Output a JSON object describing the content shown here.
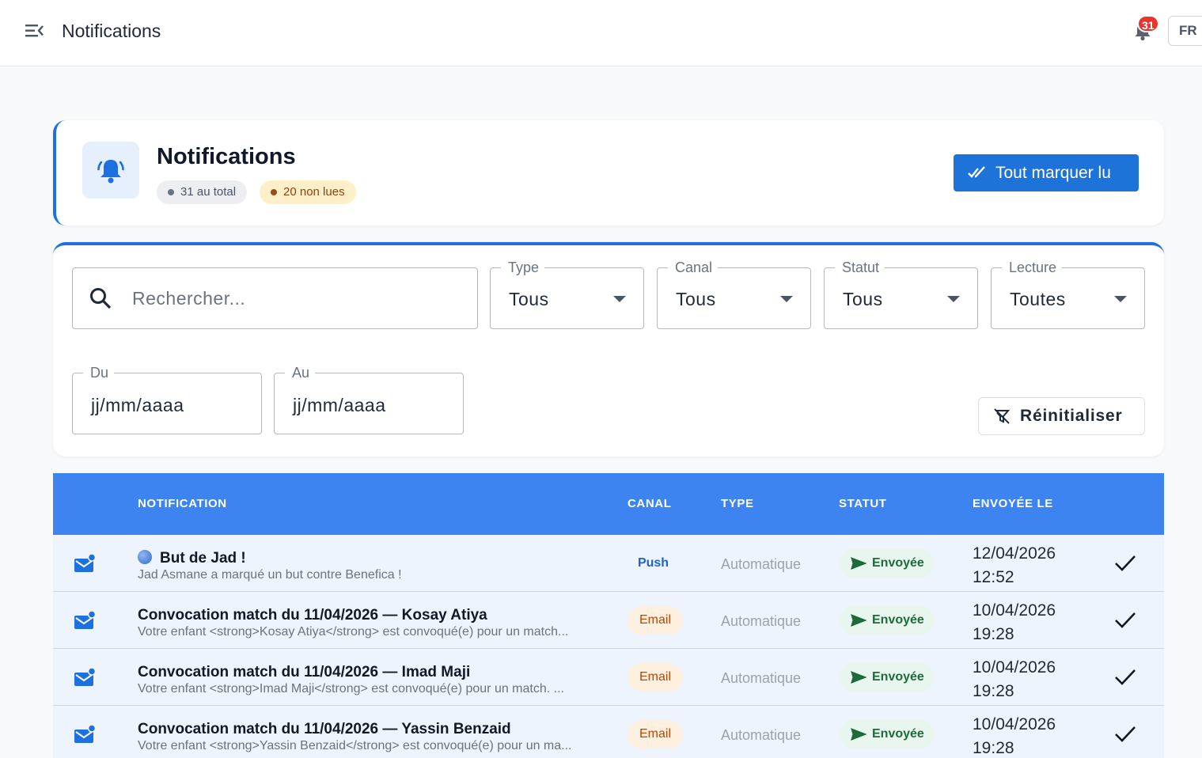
{
  "topbar": {
    "title": "Notifications",
    "notification_count": "31",
    "language": "FR"
  },
  "header": {
    "title": "Notifications",
    "total_label": "31 au total",
    "unread_label": "20 non lues",
    "mark_all_label": "Tout marquer lu"
  },
  "filters": {
    "search_placeholder": "Rechercher...",
    "type": {
      "label": "Type",
      "value": "Tous"
    },
    "canal": {
      "label": "Canal",
      "value": "Tous"
    },
    "statut": {
      "label": "Statut",
      "value": "Tous"
    },
    "lecture": {
      "label": "Lecture",
      "value": "Toutes"
    },
    "from": {
      "label": "Du",
      "value": "jj/mm/aaaa"
    },
    "to": {
      "label": "Au",
      "value": "jj/mm/aaaa"
    },
    "reset_label": "Réinitialiser"
  },
  "table": {
    "headers": {
      "notification": "NOTIFICATION",
      "canal": "CANAL",
      "type": "TYPE",
      "statut": "STATUT",
      "sent_at": "ENVOYÉE LE"
    },
    "rows": [
      {
        "title": "But de Jad !",
        "subtitle": "Jad Asmane a marqué un but contre Benefica !",
        "canal": "Push",
        "type": "Automatique",
        "status": "Envoyée",
        "date": "12/04/2026",
        "time": "12:52",
        "icon": "mail-unread-icon",
        "title_icon": "globe-icon"
      },
      {
        "title": "Convocation match du 11/04/2026 — Kosay Atiya",
        "subtitle": "Votre enfant <strong>Kosay Atiya</strong> est convoqué(e) pour un match...",
        "canal": "Email",
        "type": "Automatique",
        "status": "Envoyée",
        "date": "10/04/2026",
        "time": "19:28",
        "icon": "mail-unread-icon"
      },
      {
        "title": "Convocation match du 11/04/2026 — Imad Maji",
        "subtitle": "Votre enfant <strong>Imad Maji</strong> est convoqué(e) pour un match. ...",
        "canal": "Email",
        "type": "Automatique",
        "status": "Envoyée",
        "date": "10/04/2026",
        "time": "19:28",
        "icon": "mail-unread-icon"
      },
      {
        "title": "Convocation match du 11/04/2026 — Yassin Benzaid",
        "subtitle": "Votre enfant <strong>Yassin Benzaid</strong> est convoqué(e) pour un ma...",
        "canal": "Email",
        "type": "Automatique",
        "status": "Envoyée",
        "date": "10/04/2026",
        "time": "19:28",
        "icon": "mail-unread-icon"
      }
    ]
  },
  "colors": {
    "primary": "#1e73d9",
    "table_header": "#3d84f1",
    "row_background": "#eef4fe",
    "badge_red": "#e5372f",
    "status_green": "#1d6b3c",
    "email_orange": "#b54708"
  }
}
